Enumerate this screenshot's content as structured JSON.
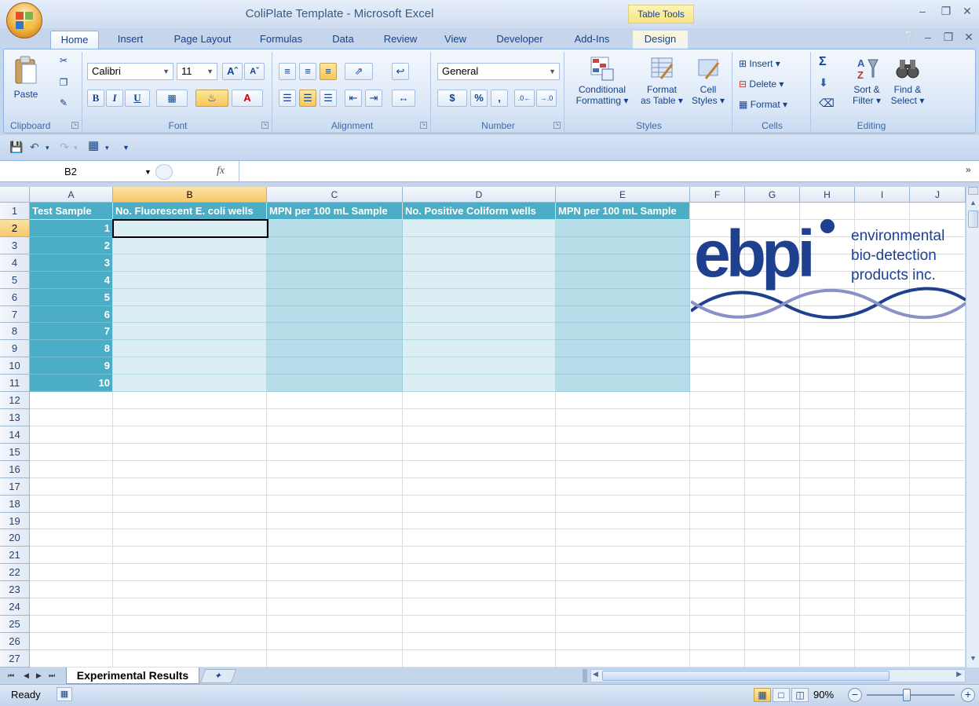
{
  "window": {
    "title": "ColiPlate Template - Microsoft Excel",
    "context_tab": "Table Tools"
  },
  "tabs": [
    "Home",
    "Insert",
    "Page Layout",
    "Formulas",
    "Data",
    "Review",
    "View",
    "Developer",
    "Add-Ins",
    "Design"
  ],
  "active_tab": "Home",
  "ribbon": {
    "clipboard": {
      "label": "Clipboard",
      "paste": "Paste"
    },
    "font": {
      "label": "Font",
      "name": "Calibri",
      "size": "11"
    },
    "alignment": {
      "label": "Alignment"
    },
    "number": {
      "label": "Number",
      "format": "General",
      "currency": "$",
      "percent": "%",
      "comma": ","
    },
    "styles": {
      "label": "Styles",
      "conditional_1": "Conditional",
      "conditional_2": "Formatting",
      "format_table_1": "Format",
      "format_table_2": "as Table",
      "cell_styles_1": "Cell",
      "cell_styles_2": "Styles"
    },
    "cells": {
      "label": "Cells",
      "insert": "Insert",
      "delete": "Delete",
      "format": "Format"
    },
    "editing": {
      "label": "Editing",
      "sort_1": "Sort &",
      "sort_2": "Filter",
      "find_1": "Find &",
      "find_2": "Select"
    }
  },
  "formula_bar": {
    "name_box": "B2",
    "fx": "fx",
    "value": ""
  },
  "columns": [
    "A",
    "B",
    "C",
    "D",
    "E",
    "F",
    "G",
    "H",
    "I",
    "J"
  ],
  "rows": [
    "1",
    "2",
    "3",
    "4",
    "5",
    "6",
    "7",
    "8",
    "9",
    "10",
    "11",
    "12",
    "13",
    "14",
    "15",
    "16",
    "17",
    "18",
    "19",
    "20",
    "21",
    "22",
    "23",
    "24",
    "25",
    "26",
    "27"
  ],
  "table": {
    "headers": [
      "Test Sample",
      "No. Fluorescent E. coli wells",
      "MPN per 100 mL Sample",
      "No. Positive Coliform wells",
      "MPN per 100 mL Sample"
    ],
    "samples": [
      "1",
      "2",
      "3",
      "4",
      "5",
      "6",
      "7",
      "8",
      "9",
      "10"
    ]
  },
  "logo": {
    "wordmark": "ebpi",
    "line1": "environmental",
    "line2": "bio-detection",
    "line3": "products inc.",
    "color_primary": "#1f3f8f",
    "color_secondary": "#8a90c8"
  },
  "sheets": {
    "active": "Experimental Results"
  },
  "status": {
    "ready": "Ready",
    "zoom": "90%"
  },
  "colors": {
    "table_header": "#4badc6",
    "band_light": "#dbeef3",
    "band_dark": "#b7dde8"
  }
}
